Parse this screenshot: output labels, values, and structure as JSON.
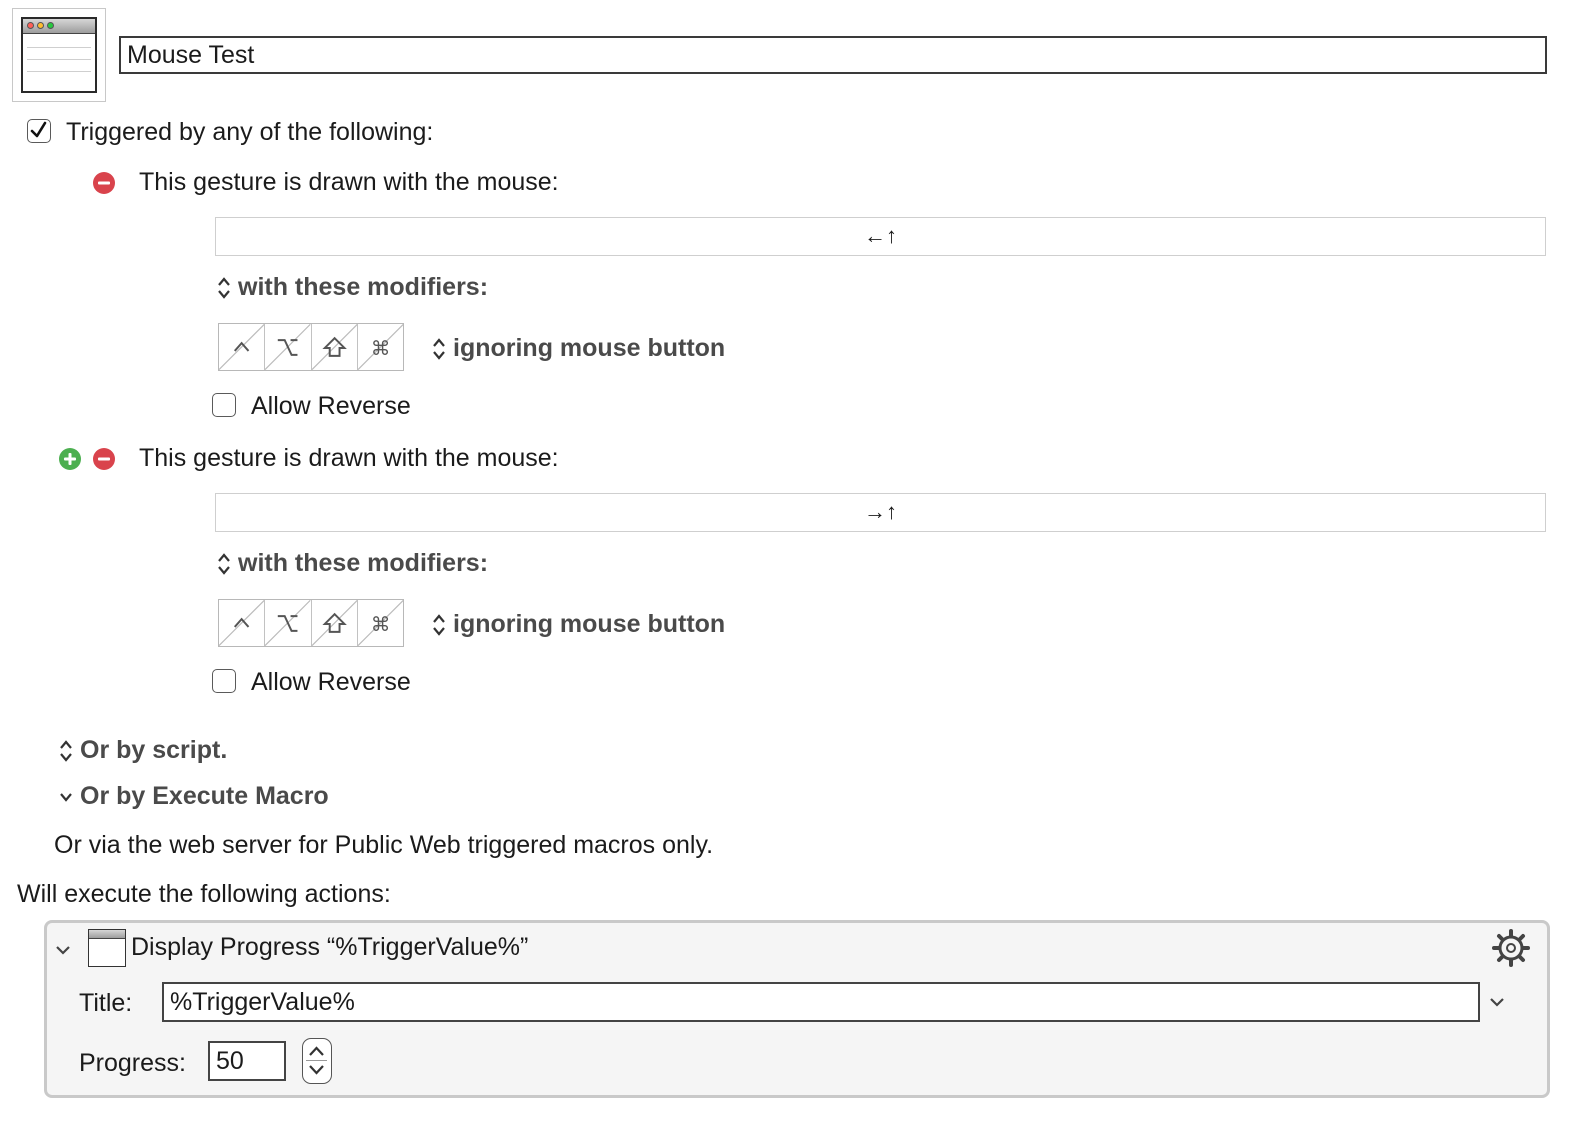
{
  "macro": {
    "icon": "window-icon",
    "name": "Mouse Test"
  },
  "trigger_group": {
    "checked": true,
    "label": "Triggered by any of the following:"
  },
  "gestures": [
    {
      "label": "This gesture is drawn with the mouse:",
      "gesture": "←↑",
      "modifiers_label": "with these modifiers:",
      "modifiers": [
        "control",
        "option",
        "shift",
        "command"
      ],
      "button_mode": "ignoring mouse button",
      "allow_reverse_label": "Allow Reverse",
      "allow_reverse": false
    },
    {
      "label": "This gesture is drawn with the mouse:",
      "gesture": "→↑",
      "modifiers_label": "with these modifiers:",
      "modifiers": [
        "control",
        "option",
        "shift",
        "command"
      ],
      "button_mode": "ignoring mouse button",
      "allow_reverse_label": "Allow Reverse",
      "allow_reverse": false
    }
  ],
  "or_by_script": "Or by script.",
  "or_by_execute_macro": "Or by Execute Macro",
  "web_server_note": "Or via the web server for Public Web triggered macros only.",
  "actions_heading": "Will execute the following actions:",
  "action": {
    "title": "Display Progress “%TriggerValue%”",
    "title_label": "Title:",
    "title_value": "%TriggerValue%",
    "progress_label": "Progress:",
    "progress_value": "50"
  },
  "colors": {
    "remove": "#d9434c",
    "add": "#4caf50"
  }
}
